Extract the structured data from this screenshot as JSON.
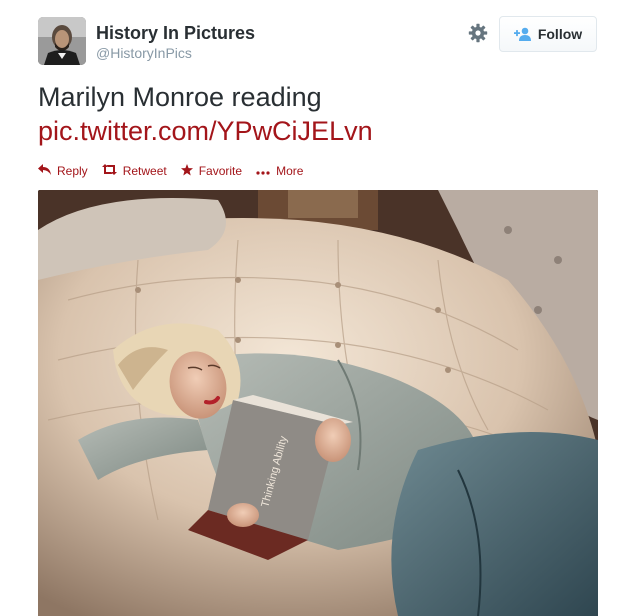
{
  "user": {
    "display_name": "History In Pictures",
    "screen_name": "@HistoryInPics",
    "avatar_icon": "portrait-avatar"
  },
  "header": {
    "settings_icon": "gear-icon",
    "follow_label": "Follow",
    "follow_icon": "person-plus-icon"
  },
  "tweet": {
    "text": "Marilyn Monroe reading",
    "link": "pic.twitter.com/YPwCiJELvn"
  },
  "actions": [
    {
      "label": "Reply",
      "icon": "reply-icon"
    },
    {
      "label": "Retweet",
      "icon": "retweet-icon"
    },
    {
      "label": "Favorite",
      "icon": "star-icon"
    },
    {
      "label": "More",
      "icon": "ellipsis-icon"
    }
  ],
  "media": {
    "book_title": "Thinking Ability"
  },
  "colors": {
    "link": "#a3151a",
    "muted": "#8899a6",
    "text": "#292f33",
    "border": "#e1e8ed"
  }
}
